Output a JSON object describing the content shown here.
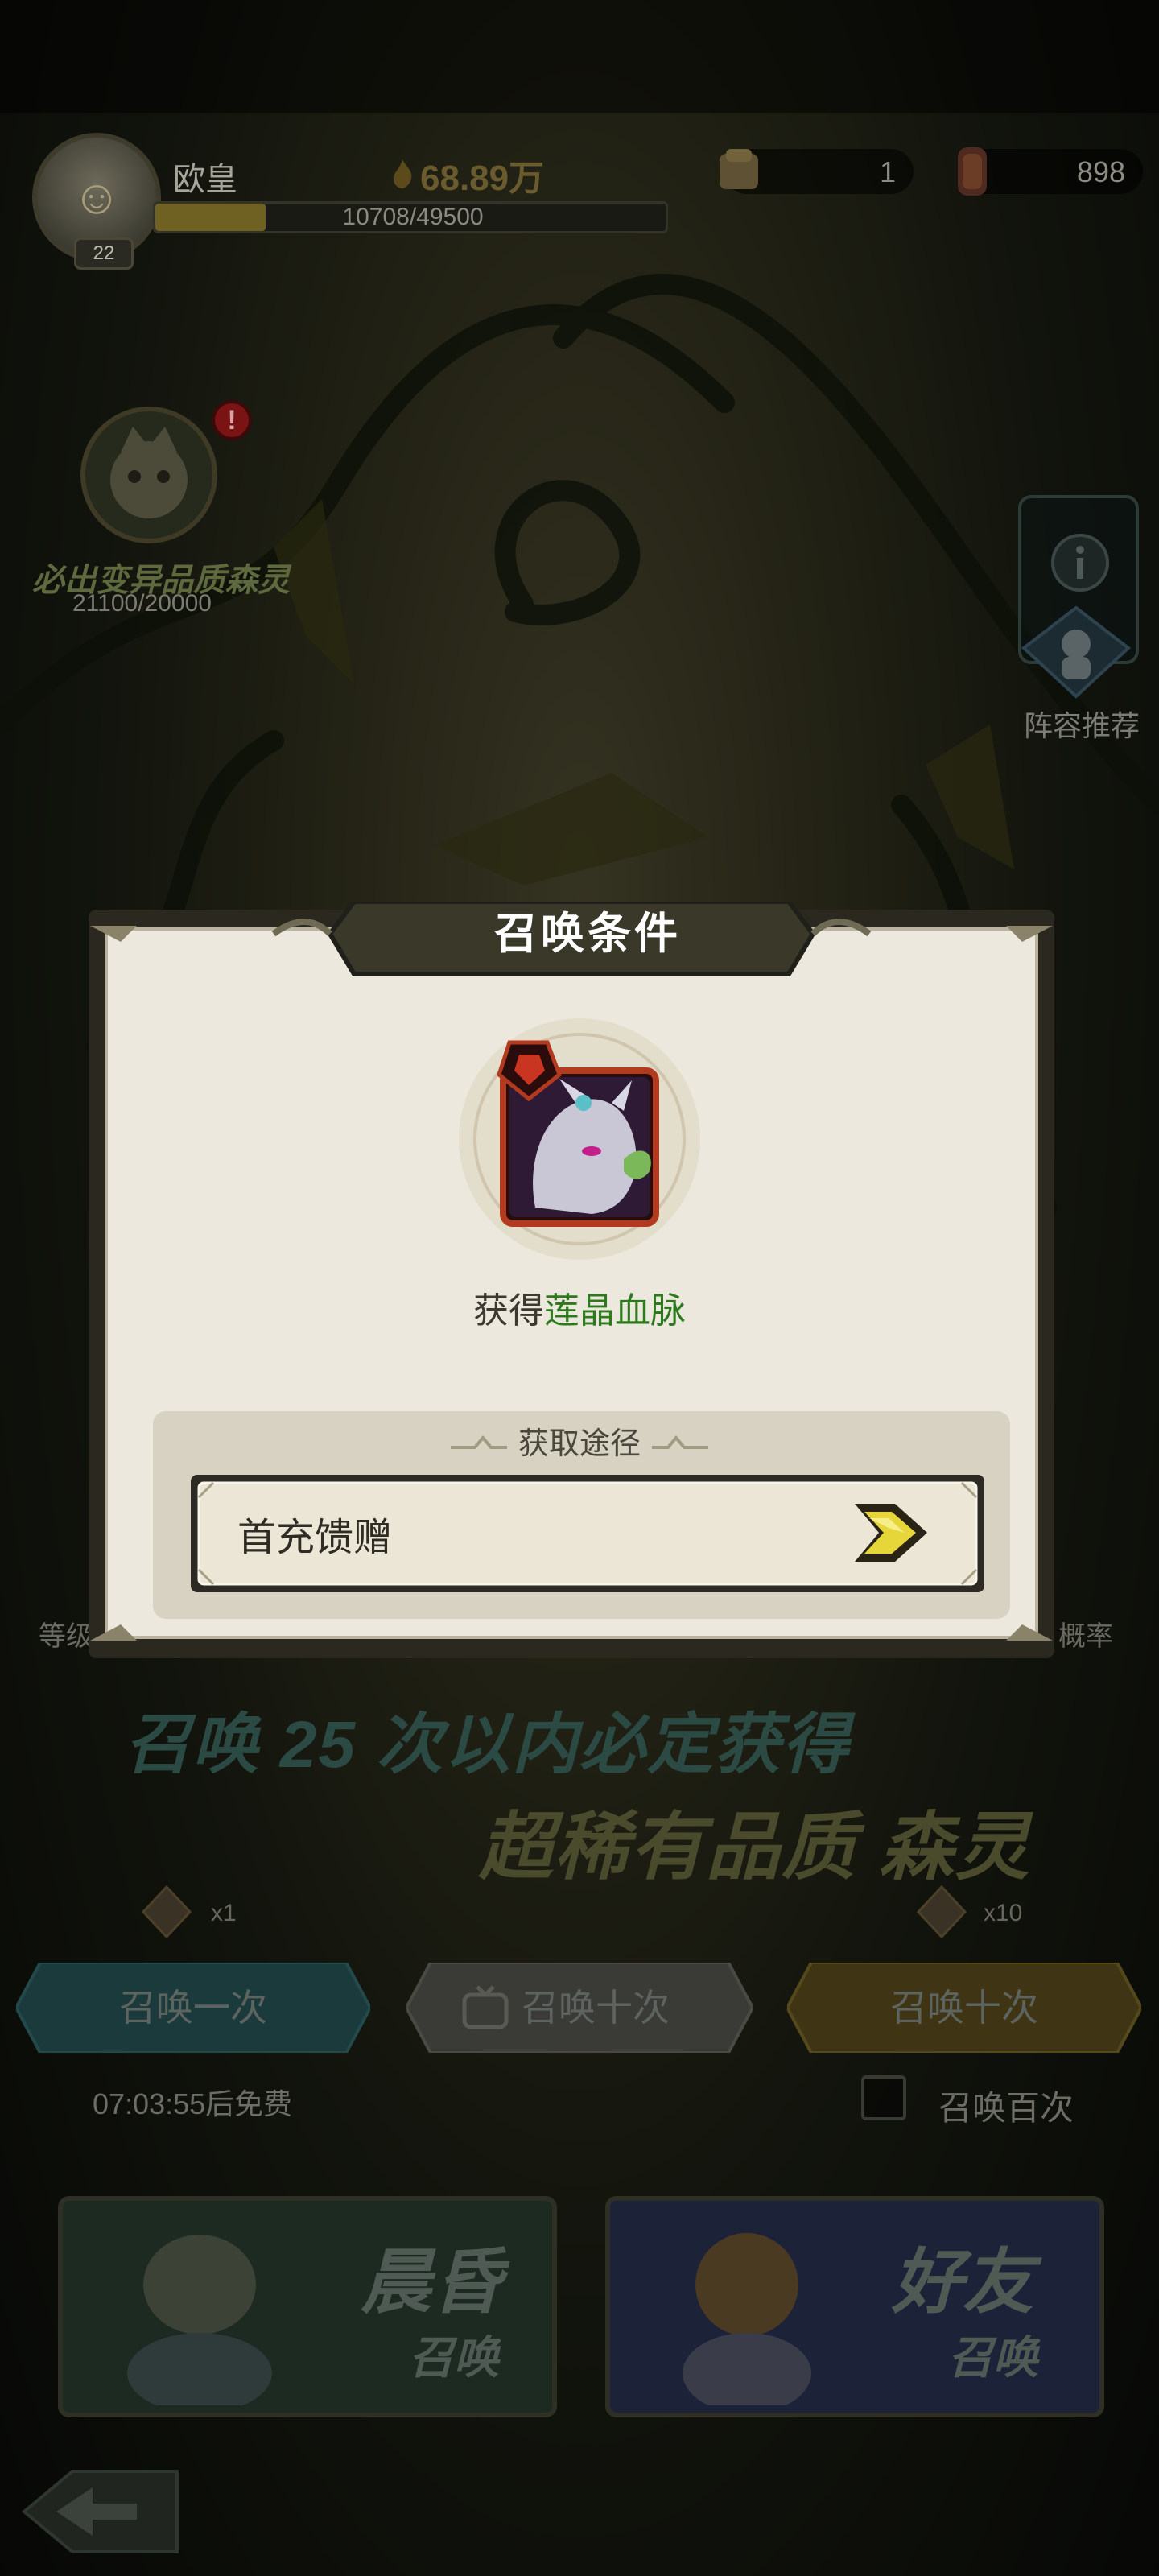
{
  "player": {
    "name": "欧皇",
    "level": "22",
    "exp_text": "10708/49500",
    "exp_fraction": 0.216,
    "power": "68.89万"
  },
  "currencies": [
    {
      "icon": "summon-scroll-icon",
      "value": "1"
    },
    {
      "icon": "premium-scroll-icon",
      "value": "898"
    }
  ],
  "event": {
    "title": "必出变异品质森灵",
    "progress": "21100/20000",
    "alert": "!"
  },
  "side": {
    "lineup_label": "阵容推荐",
    "level_label": "等级",
    "rate_label": "概率"
  },
  "banner": {
    "line1": "召唤 25 次以内必定获得",
    "line2": "超稀有品质 森灵"
  },
  "summon": {
    "single_cost": "x1",
    "ten_cost": "x10",
    "single_label": "召唤一次",
    "ad_ten_label": "召唤十次",
    "ten_label": "召唤十次",
    "free_timer": "07:03:55后免费",
    "hundred_label": "召唤百次"
  },
  "modes": [
    {
      "title": "晨昏",
      "sub": "召唤"
    },
    {
      "title": "好友",
      "sub": "召唤"
    }
  ],
  "modal": {
    "title": "召唤条件",
    "obtain_prefix": "获得",
    "obtain_name": "莲晶血脉",
    "source_header": "获取途径",
    "source_item": "首充馈赠"
  },
  "colors": {
    "accent_green": "#2d7a1e",
    "modal_paper": "#ece8dd",
    "title_plate": "#3a3828"
  }
}
